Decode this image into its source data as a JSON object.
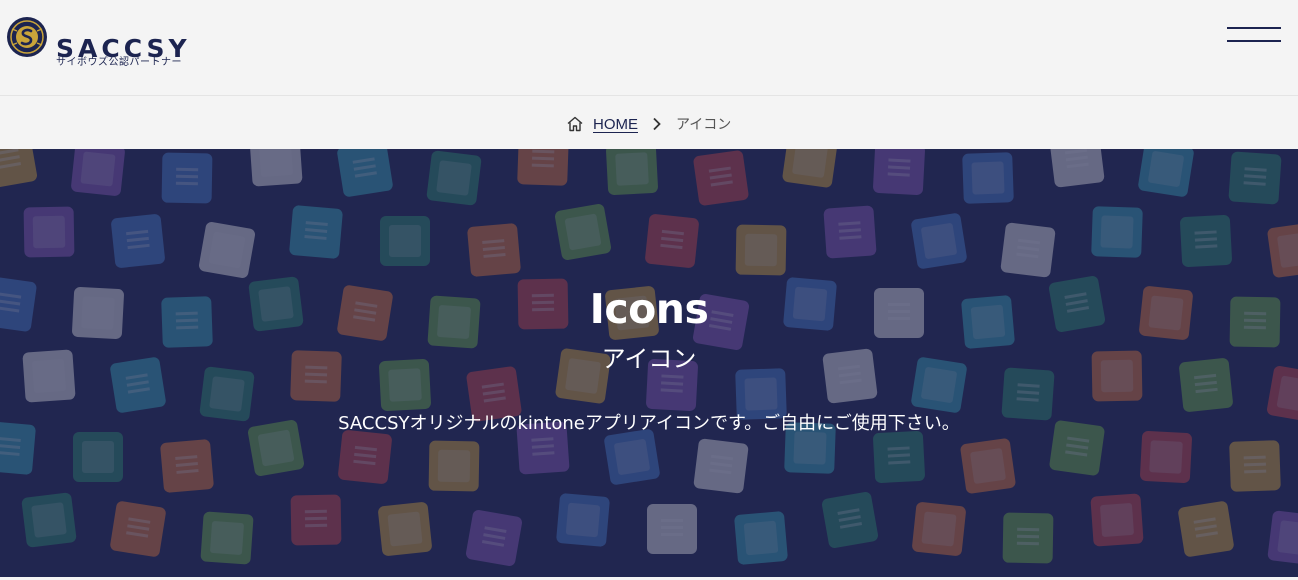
{
  "header": {
    "logo_text": "SACCSY",
    "logo_subtitle": "サイボウズ公認パートナー"
  },
  "breadcrumb": {
    "home_label": "HOME",
    "current_label": "アイコン"
  },
  "hero": {
    "title": "Icons",
    "subtitle": "アイコン",
    "description": "SACCSYオリジナルのkintoneアプリアイコンです。ご自由にご使用下さい。"
  },
  "colors": {
    "brand_navy": "#1c2450",
    "logo_gold": "#c9a43a",
    "hero_bg": "#262b55"
  },
  "icons": [
    "home-icon",
    "chevron-right-icon",
    "menu-icon",
    "logo-emblem"
  ]
}
